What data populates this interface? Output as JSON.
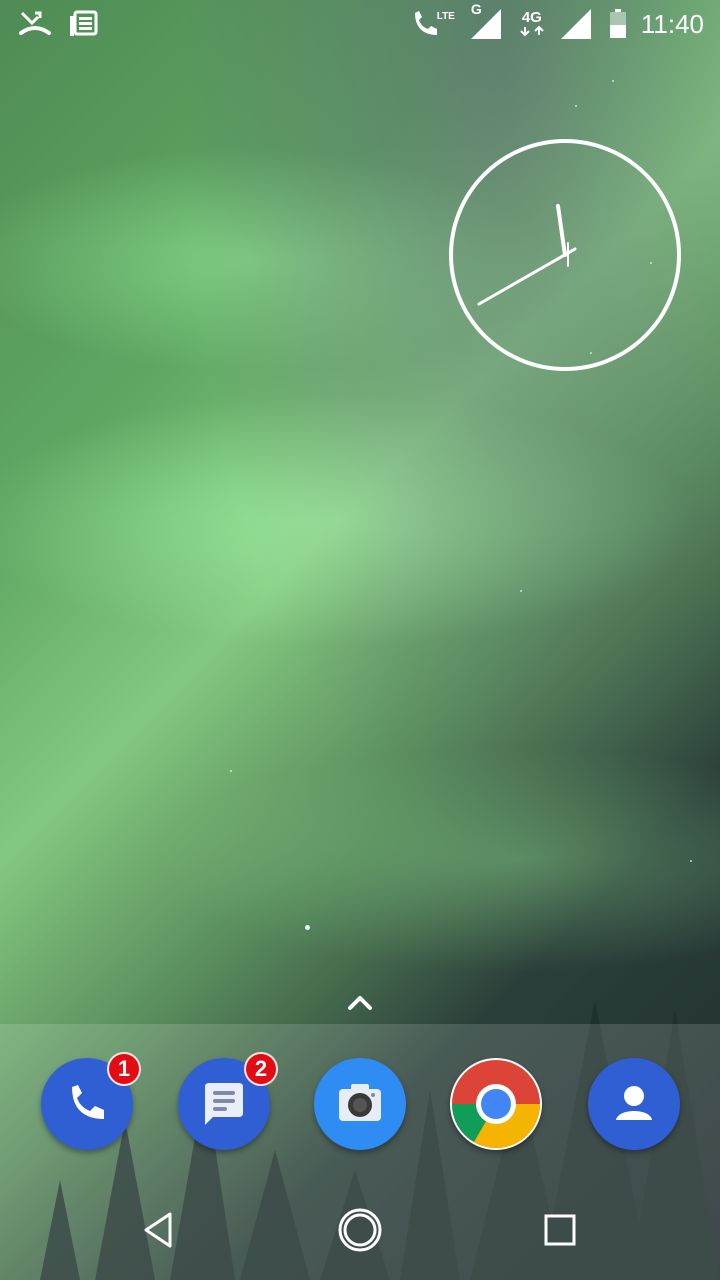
{
  "status_bar": {
    "time": "11:40",
    "left_icons": [
      "missed-call-icon",
      "news-icon"
    ],
    "right_icons": [
      "lte-call-icon",
      "g-signal-icon",
      "4g-data-icon",
      "cell-signal-icon",
      "battery-icon"
    ],
    "network_labels": {
      "lte": "LTE",
      "g": "G",
      "fourg": "4G"
    }
  },
  "clock_widget": {
    "type": "analog",
    "time": "11:40"
  },
  "dock": {
    "apps": [
      {
        "name": "Phone",
        "icon": "phone-icon",
        "badge": "1",
        "color": "#2f5fd3"
      },
      {
        "name": "Messages",
        "icon": "messages-icon",
        "badge": "2",
        "color": "#2f5fd3"
      },
      {
        "name": "Camera",
        "icon": "camera-icon",
        "badge": "",
        "color": "#2e8cf2"
      },
      {
        "name": "Chrome",
        "icon": "chrome-icon",
        "badge": "",
        "color": "#ffffff"
      },
      {
        "name": "Contacts",
        "icon": "contacts-icon",
        "badge": "",
        "color": "#2f5fd3"
      }
    ]
  },
  "nav_bar": {
    "buttons": [
      "back-icon",
      "home-icon",
      "recents-icon"
    ]
  }
}
